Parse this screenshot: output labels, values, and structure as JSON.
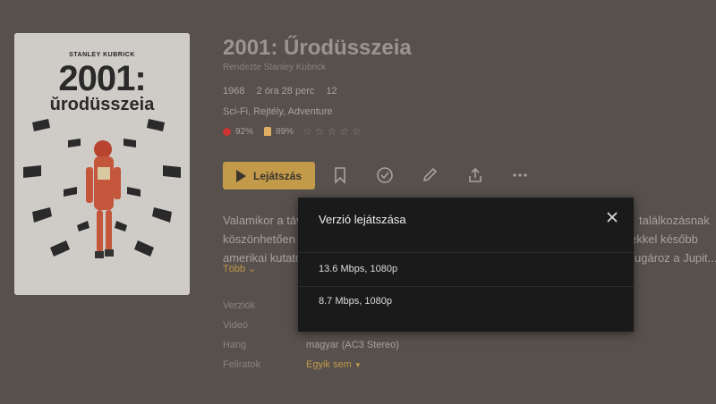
{
  "poster": {
    "director": "STANLEY KUBRICK",
    "title_main": "2001:",
    "title_sub": "ŭrodüsszeia"
  },
  "movie": {
    "title": "2001: Űrodüsszeia",
    "director_line": "Rendezte Stanley Kubrick",
    "year": "1968",
    "duration": "2 óra 28 perc",
    "age_rating": "12",
    "genres": "Sci-Fi, Rejtély, Adventure",
    "critic_score": "92%",
    "audience_score": "89%",
    "user_rating_stars": 0,
    "description_lines": [
      "Valamikor a táv",
      "köszönhetően a",
      "amerikai kutató",
      "találkozásnak",
      "ekkel később",
      "ugároz a Jupit..."
    ],
    "more_label": "Több"
  },
  "actions": {
    "play_label": "Lejátszás",
    "icons": [
      "bookmark-icon",
      "check-circle-icon",
      "edit-pencil-icon",
      "share-icon",
      "more-dots-icon"
    ]
  },
  "details": {
    "versions_label": "Verziók",
    "video_label": "Videó",
    "audio_label": "Hang",
    "audio_value": "magyar (AC3 Stereo)",
    "subtitles_label": "Feliratok",
    "subtitles_value": "Egyik sem"
  },
  "modal": {
    "title": "Verzió lejátszása",
    "options": [
      {
        "label": "13.6 Mbps, 1080p"
      },
      {
        "label": "8.7 Mbps, 1080p"
      }
    ]
  }
}
